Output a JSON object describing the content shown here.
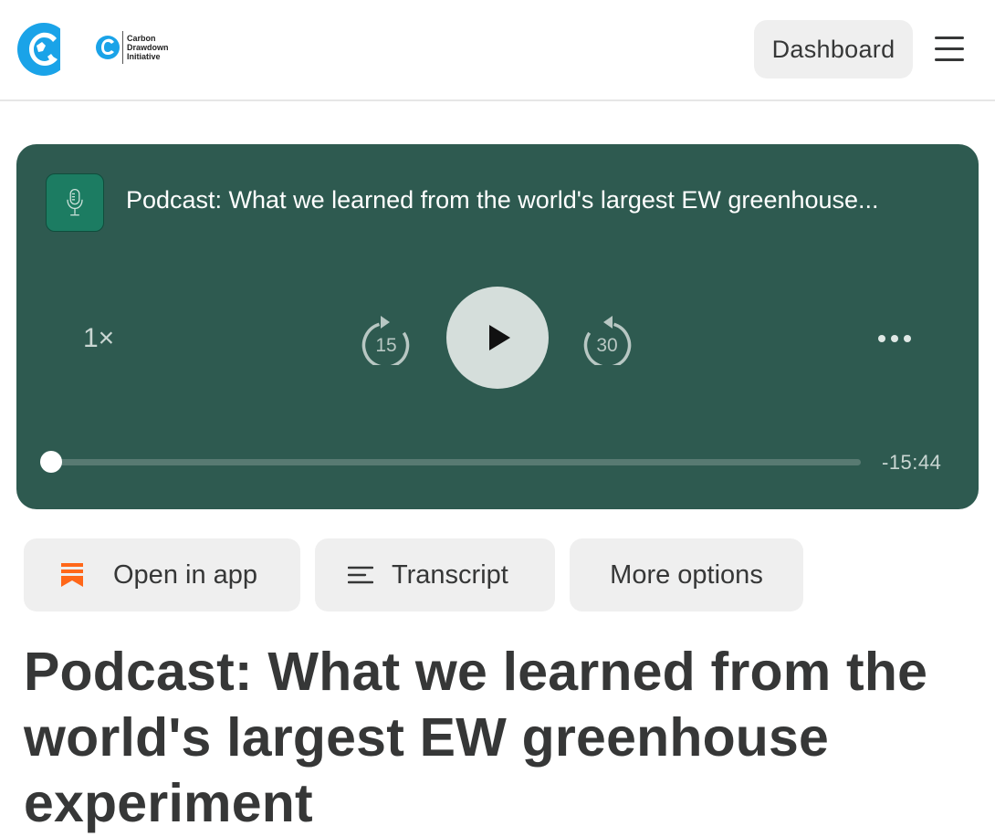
{
  "header": {
    "logo_text": [
      "Carbon",
      "Drawdown",
      "Initiative"
    ],
    "dashboard_label": "Dashboard",
    "menu_icon": "hamburger-menu-icon"
  },
  "player": {
    "title": "Podcast: What we learned from the world's largest EW greenhouse...",
    "speed": "1×",
    "skip_back_seconds": "15",
    "skip_forward_seconds": "30",
    "remaining_time": "-15:44",
    "progress_percent": 0,
    "background_color": "#2e5a50"
  },
  "actions": {
    "open_in_app": "Open in app",
    "transcript": "Transcript",
    "more_options": "More options",
    "accent_color": "#ff6719"
  },
  "article": {
    "title": "Podcast: What we learned from the world's largest EW greenhouse experiment"
  },
  "brand": {
    "logo_color": "#1aa3e8"
  }
}
